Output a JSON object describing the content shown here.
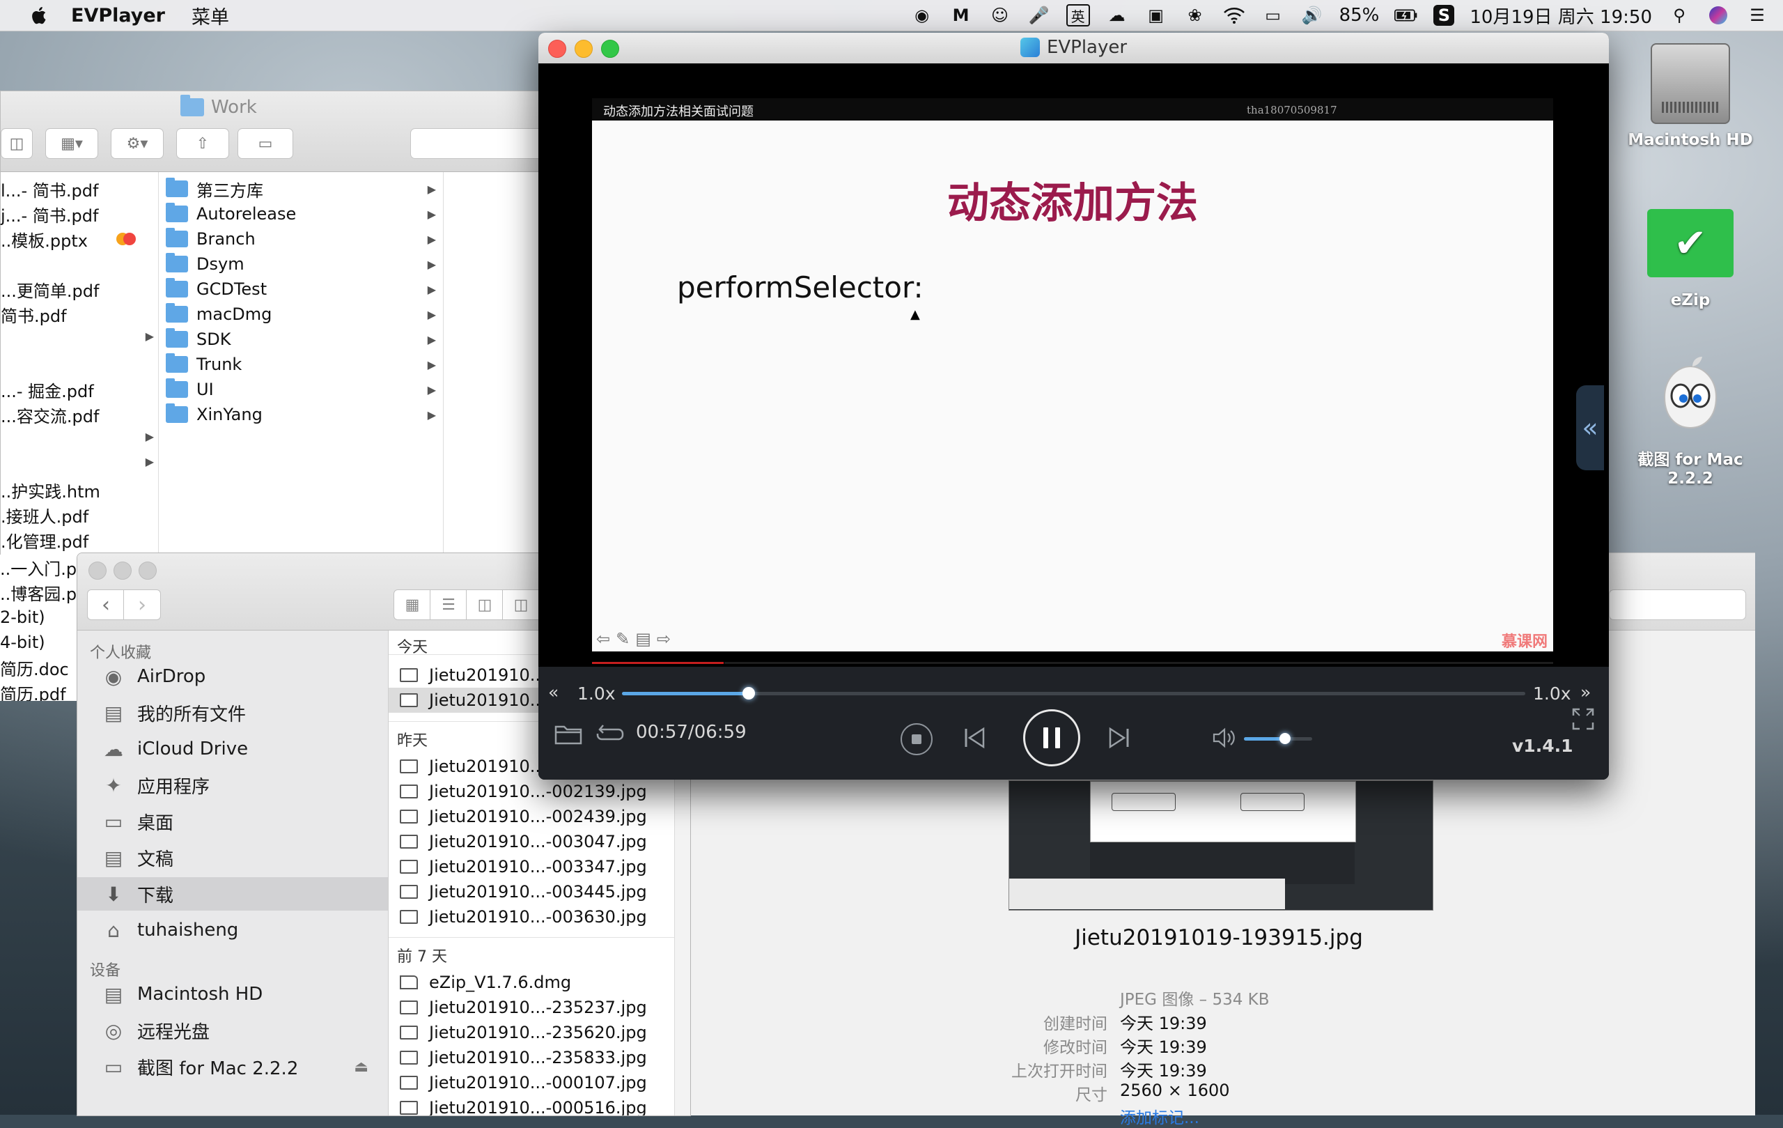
{
  "menubar": {
    "app_name": "EVPlayer",
    "menu_item": "菜单",
    "battery": "85%",
    "datetime": "10月19日 周六  19:50",
    "input_method": "英"
  },
  "finder_back": {
    "title": "Work",
    "col1_files": [
      "l...- 简书.pdf",
      "j...- 简书.pdf",
      "..模板.pptx",
      "...更简单.pdf",
      "简书.pdf",
      "...- 掘金.pdf",
      "...容交流.pdf",
      "..护实践.htm",
      ".接班人.pdf",
      ".化管理.pdf",
      "..一入门.pdf",
      "..博客园.pdf",
      "2-bit)",
      "4-bit)",
      "简历.doc",
      "简历.pdf"
    ],
    "folders": [
      "第三方库",
      "Autorelease",
      "Branch",
      "Dsym",
      "GCDTest",
      "macDmg",
      "SDK",
      "Trunk",
      "UI",
      "XinYang"
    ]
  },
  "finder_front": {
    "favorites_header": "个人收藏",
    "devices_header": "设备",
    "favorites": [
      {
        "label": "AirDrop",
        "icon": "airdrop-icon"
      },
      {
        "label": "我的所有文件",
        "icon": "all-files-icon"
      },
      {
        "label": "iCloud Drive",
        "icon": "cloud-icon"
      },
      {
        "label": "应用程序",
        "icon": "applications-icon"
      },
      {
        "label": "桌面",
        "icon": "desktop-icon"
      },
      {
        "label": "文稿",
        "icon": "documents-icon"
      },
      {
        "label": "下载",
        "icon": "downloads-icon"
      },
      {
        "label": "tuhaisheng",
        "icon": "home-icon"
      }
    ],
    "devices": [
      {
        "label": "Macintosh HD",
        "icon": "disk-icon"
      },
      {
        "label": "远程光盘",
        "icon": "optical-disc-icon"
      },
      {
        "label": "截图 for Mac 2.2.2",
        "icon": "disk-icon"
      }
    ],
    "sections": {
      "today": "今天",
      "yesterday": "昨天",
      "last7": "前 7 天"
    },
    "files_today": [
      "Jietu201910...",
      "Jietu201910..."
    ],
    "files_yesterday": [
      "Jietu201910...",
      "Jietu201910...-002139.jpg",
      "Jietu201910...-002439.jpg",
      "Jietu201910...-003047.jpg",
      "Jietu201910...-003347.jpg",
      "Jietu201910...-003445.jpg",
      "Jietu201910...-003630.jpg"
    ],
    "files_last7": [
      "eZip_V1.7.6.dmg",
      "Jietu201910...-235237.jpg",
      "Jietu201910...-235620.jpg",
      "Jietu201910...-235833.jpg",
      "Jietu201910...-000107.jpg",
      "Jietu201910...-000516.jpg"
    ]
  },
  "info": {
    "filename": "Jietu20191019-193915.jpg",
    "kind": "JPEG 图像 – 534 KB",
    "rows": [
      {
        "label": "创建时间",
        "value": "今天 19:39"
      },
      {
        "label": "修改时间",
        "value": "今天 19:39"
      },
      {
        "label": "上次打开时间",
        "value": "今天 19:39"
      },
      {
        "label": "尺寸",
        "value": "2560 × 1600"
      }
    ],
    "add_tags": "添加标记..."
  },
  "desktop": {
    "icons": [
      "Macintosh HD",
      "eZip",
      "截图 for Mac 2.2.2"
    ]
  },
  "player": {
    "window_title": "EVPlayer",
    "slide_header": "动态添加方法相关面试问题",
    "watermark": "tha18070509817",
    "slide_title": "动态添加方法",
    "slide_body": "performSelector:",
    "brand": "慕课网",
    "speed_left": "1.0x",
    "speed_right": "1.0x",
    "time": "00:57/06:59",
    "version": "v1.4.1",
    "playback_progress": 0.137,
    "rate_slider_value": 0.14,
    "volume_value": 0.6
  },
  "colors": {
    "slide_title": "#9b1b4c",
    "accent_blue": "#5ba7e6",
    "close": "#fc5f57",
    "minimize": "#fdbc2e",
    "zoom": "#33c748"
  }
}
